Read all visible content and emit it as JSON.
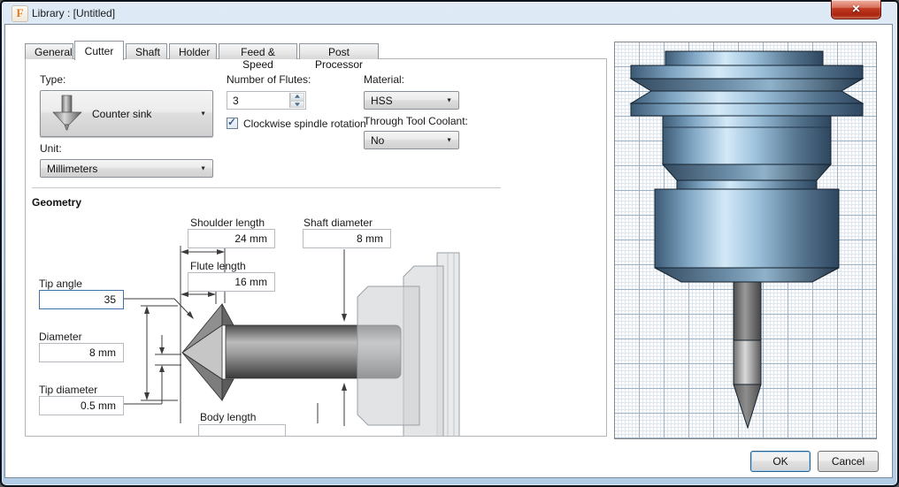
{
  "window": {
    "title": "Library :  [Untitled]",
    "app_icon_letter": "F"
  },
  "icons": {
    "close": "✕",
    "combo_arrow": "▼",
    "check": "✓",
    "countersink_tool": "countersink-tool-icon"
  },
  "tabs": [
    {
      "label": "General",
      "active": false
    },
    {
      "label": "Cutter",
      "active": true
    },
    {
      "label": "Shaft",
      "active": false
    },
    {
      "label": "Holder",
      "active": false
    },
    {
      "label": "Feed & Speed",
      "active": false
    },
    {
      "label": "Post Processor",
      "active": false
    }
  ],
  "cutter": {
    "type_label": "Type:",
    "type_value": "Counter sink",
    "unit_label": "Unit:",
    "unit_value": "Millimeters",
    "flutes_label": "Number of Flutes:",
    "flutes_value": "3",
    "spindle_checkbox_label": "Clockwise spindle rotation",
    "spindle_checked": true,
    "material_label": "Material:",
    "material_value": "HSS",
    "coolant_label": "Through Tool Coolant:",
    "coolant_value": "No"
  },
  "geometry": {
    "section_title": "Geometry",
    "fields": [
      {
        "label": "Shoulder length",
        "value": "24 mm"
      },
      {
        "label": "Shaft diameter",
        "value": "8 mm"
      },
      {
        "label": "Flute length",
        "value": "16 mm"
      },
      {
        "label": "Tip angle",
        "value": "35"
      },
      {
        "label": "Diameter",
        "value": "8 mm"
      },
      {
        "label": "Tip diameter",
        "value": "0.5 mm"
      },
      {
        "label": "Body length",
        "value": ""
      }
    ]
  },
  "footer": {
    "ok_label": "OK",
    "cancel_label": "Cancel"
  },
  "colors": {
    "accent_blue_frame": "#b4cde7",
    "close_red": "#aa2410",
    "grid_major": "#9cb1c4",
    "grid_minor": "#dee6ee",
    "tool_steel_blue": "#7fa6c4",
    "focus_border": "#3f72a6"
  }
}
